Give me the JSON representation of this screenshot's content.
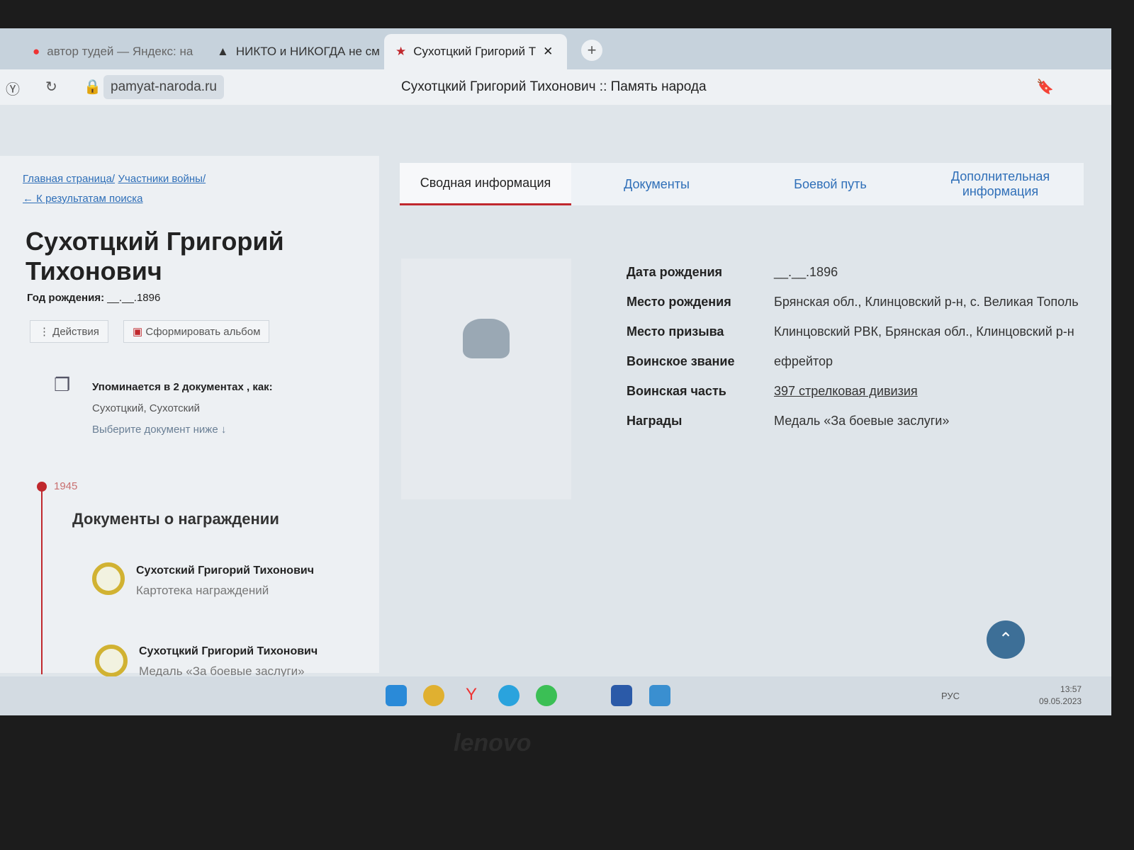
{
  "browser": {
    "tabs": [
      {
        "label": "автор тудей — Яндекс: на"
      },
      {
        "label": "НИКТО и НИКОГДА не см"
      },
      {
        "label": "Сухотцкий Григорий Т"
      }
    ],
    "url": "pamyat-naroda.ru",
    "page_title": "Сухотцкий Григорий Тихонович :: Память народа"
  },
  "breadcrumb": {
    "home": "Главная страница/",
    "participants": "Участники войны/",
    "back": "← К результатам поиска"
  },
  "person": {
    "name": "Сухотцкий Григорий Тихонович",
    "birth_label": "Год рождения:",
    "birth_value": "__.__.1896"
  },
  "actions": {
    "actions": "⋮ Действия",
    "album": "Сформировать альбом"
  },
  "mentions": {
    "title": "Упоминается в 2 документах , как:",
    "names": "Сухотцкий, Сухотский",
    "hint": "Выберите документ ниже ↓"
  },
  "timeline": {
    "year": "1945",
    "section": "Документы о награждении",
    "docs": [
      {
        "name": "Сухотский Григорий Тихонович",
        "type": "Картотека награждений"
      },
      {
        "name": "Сухотцкий Григорий Тихонович",
        "type": "Медаль «За боевые заслуги»"
      }
    ]
  },
  "tabs": [
    "Сводная информация",
    "Документы",
    "Боевой путь",
    "Дополнительная информация"
  ],
  "info": [
    {
      "k": "Дата рождения",
      "v": "__.__.1896"
    },
    {
      "k": "Место рождения",
      "v": "Брянская обл., Клинцовский р-н, с. Великая Тополь"
    },
    {
      "k": "Место призыва",
      "v": "Клинцовский РВК, Брянская обл., Клинцовский р-н"
    },
    {
      "k": "Воинское звание",
      "v": "ефрейтор"
    },
    {
      "k": "Воинская часть",
      "v": "397 стрелковая дивизия"
    },
    {
      "k": "Награды",
      "v": "Медаль «За боевые заслуги»"
    }
  ],
  "tray": {
    "lang": "РУС",
    "time": "13:57",
    "date": "09.05.2023"
  },
  "bezel": {
    "brand": "lenovo"
  }
}
